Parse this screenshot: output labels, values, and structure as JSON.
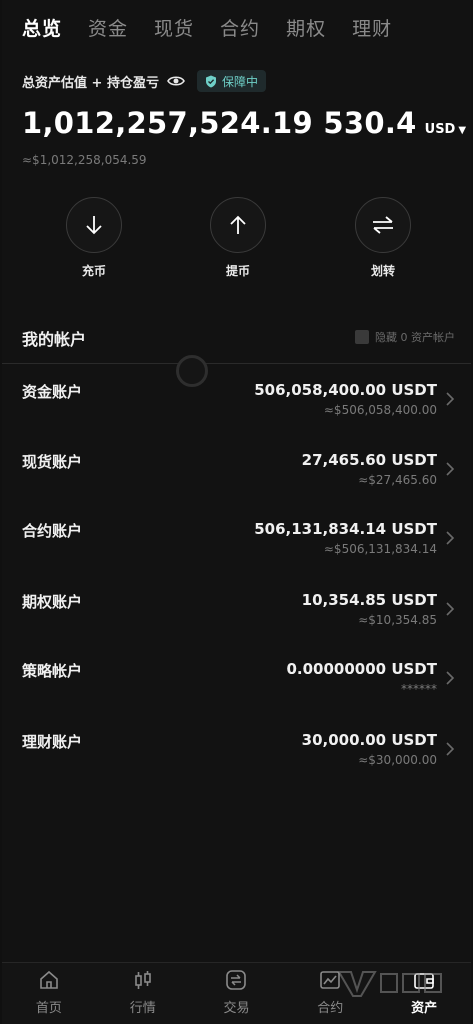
{
  "tabs": [
    "总览",
    "资金",
    "现货",
    "合约",
    "期权",
    "理财"
  ],
  "header": {
    "asset_label": "总资产估值 + 持仓盈亏",
    "protect_label": "保障中",
    "total_amount": "1,012,257,524.19 530.4",
    "currency": "USD",
    "approx_total": "≈$1,012,258,054.59"
  },
  "actions": {
    "deposit": "充币",
    "withdraw": "提币",
    "transfer": "划转"
  },
  "accounts_section": {
    "title": "我的帐户",
    "hide_label": "隐藏 0 资产帐户"
  },
  "accounts": [
    {
      "name": "资金账户",
      "amount": "506,058,400.00 USDT",
      "approx": "≈$506,058,400.00"
    },
    {
      "name": "现货账户",
      "amount": "27,465.60 USDT",
      "approx": "≈$27,465.60"
    },
    {
      "name": "合约账户",
      "amount": "506,131,834.14 USDT",
      "approx": "≈$506,131,834.14"
    },
    {
      "name": "期权账户",
      "amount": "10,354.85 USDT",
      "approx": "≈$10,354.85"
    },
    {
      "name": "策略帐户",
      "amount": "0.00000000 USDT",
      "approx": "******"
    },
    {
      "name": "理财账户",
      "amount": "30,000.00 USDT",
      "approx": "≈$30,000.00"
    }
  ],
  "bottom_nav": [
    "首页",
    "行情",
    "交易",
    "合约",
    "资产"
  ],
  "colors": {
    "background": "#121212",
    "accent_teal": "#6fd0c8",
    "muted_text": "#7a7a7a"
  }
}
